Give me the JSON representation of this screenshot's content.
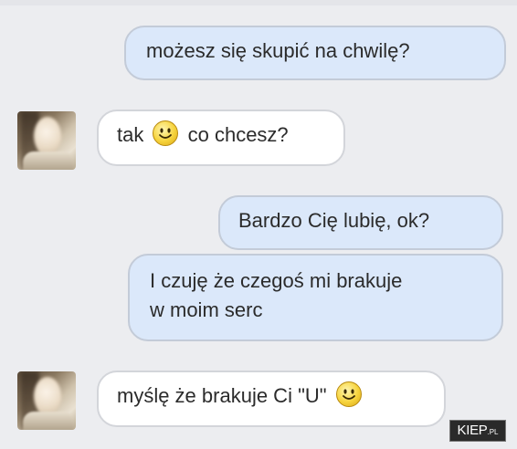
{
  "messages": [
    {
      "side": "out",
      "text": "możesz się skupić na chwilę?"
    },
    {
      "side": "in",
      "before": "tak",
      "emoji": "smiley-emoji",
      "after": "co chcesz?"
    },
    {
      "side": "out",
      "text": "Bardzo Cię lubię, ok?"
    },
    {
      "side": "out",
      "line1": "I czuję że czegoś mi brakuje",
      "line2": "w moim serc"
    },
    {
      "side": "in",
      "text": "myślę że brakuje Ci \"U\"",
      "emoji": "smiley-emoji"
    }
  ],
  "avatars": [
    "avatar-contact",
    "avatar-contact"
  ],
  "watermark": {
    "main": "KIEP",
    "suffix": ".PL"
  },
  "colors": {
    "outgoing_bubble": "#dbe8fa",
    "incoming_bubble": "#ffffff",
    "background": "#ecedf0"
  }
}
